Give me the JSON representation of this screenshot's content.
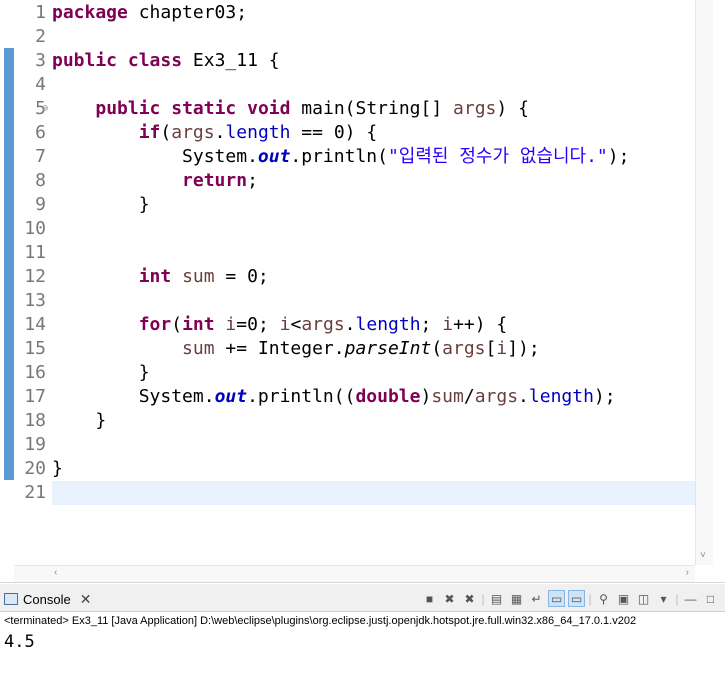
{
  "editor": {
    "line_numbers": [
      "1",
      "2",
      "3",
      "4",
      "5",
      "6",
      "7",
      "8",
      "9",
      "10",
      "11",
      "12",
      "13",
      "14",
      "15",
      "16",
      "17",
      "18",
      "19",
      "20",
      "21"
    ],
    "code_lines": [
      [
        {
          "t": "package",
          "c": "kw"
        },
        {
          "t": " chapter03;",
          "c": ""
        }
      ],
      [],
      [
        {
          "t": "public",
          "c": "kw"
        },
        {
          "t": " ",
          "c": ""
        },
        {
          "t": "class",
          "c": "kw"
        },
        {
          "t": " Ex3_11 {",
          "c": ""
        }
      ],
      [],
      [
        {
          "t": "    ",
          "c": ""
        },
        {
          "t": "public",
          "c": "kw"
        },
        {
          "t": " ",
          "c": ""
        },
        {
          "t": "static",
          "c": "kw"
        },
        {
          "t": " ",
          "c": ""
        },
        {
          "t": "void",
          "c": "kw"
        },
        {
          "t": " main(String[] ",
          "c": ""
        },
        {
          "t": "args",
          "c": "var"
        },
        {
          "t": ") {",
          "c": ""
        }
      ],
      [
        {
          "t": "        ",
          "c": ""
        },
        {
          "t": "if",
          "c": "kw"
        },
        {
          "t": "(",
          "c": ""
        },
        {
          "t": "args",
          "c": "var"
        },
        {
          "t": ".",
          "c": ""
        },
        {
          "t": "length",
          "c": "fld"
        },
        {
          "t": " == 0) {",
          "c": ""
        }
      ],
      [
        {
          "t": "            System.",
          "c": ""
        },
        {
          "t": "out",
          "c": "sfld"
        },
        {
          "t": ".println(",
          "c": ""
        },
        {
          "t": "\"입력된 정수가 없습니다.\"",
          "c": "str"
        },
        {
          "t": ");",
          "c": ""
        }
      ],
      [
        {
          "t": "            ",
          "c": ""
        },
        {
          "t": "return",
          "c": "kw"
        },
        {
          "t": ";",
          "c": ""
        }
      ],
      [
        {
          "t": "        }",
          "c": ""
        }
      ],
      [],
      [],
      [
        {
          "t": "        ",
          "c": ""
        },
        {
          "t": "int",
          "c": "kw"
        },
        {
          "t": " ",
          "c": ""
        },
        {
          "t": "sum",
          "c": "var"
        },
        {
          "t": " = 0;",
          "c": ""
        }
      ],
      [],
      [
        {
          "t": "        ",
          "c": ""
        },
        {
          "t": "for",
          "c": "kw"
        },
        {
          "t": "(",
          "c": ""
        },
        {
          "t": "int",
          "c": "kw"
        },
        {
          "t": " ",
          "c": ""
        },
        {
          "t": "i",
          "c": "var"
        },
        {
          "t": "=0; ",
          "c": ""
        },
        {
          "t": "i",
          "c": "var"
        },
        {
          "t": "<",
          "c": ""
        },
        {
          "t": "args",
          "c": "var"
        },
        {
          "t": ".",
          "c": ""
        },
        {
          "t": "length",
          "c": "fld"
        },
        {
          "t": "; ",
          "c": ""
        },
        {
          "t": "i",
          "c": "var"
        },
        {
          "t": "++) {",
          "c": ""
        }
      ],
      [
        {
          "t": "            ",
          "c": ""
        },
        {
          "t": "sum",
          "c": "var"
        },
        {
          "t": " += Integer.",
          "c": ""
        },
        {
          "t": "parseInt",
          "c": "smeth"
        },
        {
          "t": "(",
          "c": ""
        },
        {
          "t": "args",
          "c": "var"
        },
        {
          "t": "[",
          "c": ""
        },
        {
          "t": "i",
          "c": "var"
        },
        {
          "t": "]);",
          "c": ""
        }
      ],
      [
        {
          "t": "        }",
          "c": ""
        }
      ],
      [
        {
          "t": "        System.",
          "c": ""
        },
        {
          "t": "out",
          "c": "sfld"
        },
        {
          "t": ".println((",
          "c": ""
        },
        {
          "t": "double",
          "c": "kw"
        },
        {
          "t": ")",
          "c": ""
        },
        {
          "t": "sum",
          "c": "var"
        },
        {
          "t": "/",
          "c": ""
        },
        {
          "t": "args",
          "c": "var"
        },
        {
          "t": ".",
          "c": ""
        },
        {
          "t": "length",
          "c": "fld"
        },
        {
          "t": ");",
          "c": ""
        }
      ],
      [
        {
          "t": "    }",
          "c": ""
        }
      ],
      [],
      [
        {
          "t": "}",
          "c": ""
        }
      ],
      []
    ]
  },
  "console": {
    "tab_label": "Console",
    "status": "<terminated> Ex3_11 [Java Application] D:\\web\\eclipse\\plugins\\org.eclipse.justj.openjdk.hotspot.jre.full.win32.x86_64_17.0.1.v202",
    "output": "4.5",
    "toolbar_icons": [
      "terminate-icon",
      "remove-launch-icon",
      "remove-all-terminated-icon",
      "clear-console-icon",
      "scroll-lock-icon",
      "word-wrap-icon",
      "show-stdout-icon",
      "show-stderr-icon",
      "pin-console-icon",
      "display-selected-console-icon",
      "open-console-icon",
      "view-menu-icon",
      "minimize-icon",
      "maximize-icon"
    ]
  },
  "colors": {
    "keyword": "#7f0055",
    "field": "#0000c0",
    "string": "#2a00ff",
    "variable": "#6a3e3e",
    "change_bar": "#5b9bd5",
    "current_line": "#e8f2fe",
    "output_highlight": "#f3f70a"
  }
}
